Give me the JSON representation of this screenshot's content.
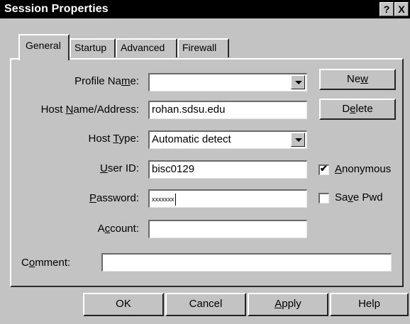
{
  "window": {
    "title": "Session Properties",
    "help_glyph": "?",
    "close_glyph": "X"
  },
  "tabs": [
    {
      "label": "General",
      "active": true
    },
    {
      "label": "Startup",
      "active": false
    },
    {
      "label": "Advanced",
      "active": false
    },
    {
      "label": "Firewall",
      "active": false
    }
  ],
  "form": {
    "profile_name": {
      "label_pre": "Profile Na",
      "label_key": "m",
      "label_post": "e:",
      "value": ""
    },
    "host_name": {
      "label_pre": "Host ",
      "label_key": "N",
      "label_post": "ame/Address:",
      "value": "rohan.sdsu.edu"
    },
    "host_type": {
      "label_pre": "Host ",
      "label_key": "T",
      "label_post": "ype:",
      "value": "Automatic detect"
    },
    "user_id": {
      "label_pre": "",
      "label_key": "U",
      "label_post": "ser ID:",
      "value": "bisc0129"
    },
    "password": {
      "label_pre": "",
      "label_key": "P",
      "label_post": "assword:",
      "value": "xxxxxxx"
    },
    "account": {
      "label_pre": "A",
      "label_key": "c",
      "label_post": "count:",
      "value": ""
    },
    "comment": {
      "label_pre": "C",
      "label_key": "o",
      "label_post": "mment:",
      "value": ""
    }
  },
  "side_buttons": {
    "new": {
      "pre": "Ne",
      "key": "w",
      "post": ""
    },
    "delete": {
      "pre": "D",
      "key": "e",
      "post": "lete"
    }
  },
  "checkboxes": {
    "anonymous": {
      "pre": "",
      "key": "A",
      "post": "nonymous",
      "checked": true,
      "mark": "✔"
    },
    "save_pwd": {
      "pre": "Sa",
      "key": "v",
      "post": "e Pwd",
      "checked": false,
      "mark": ""
    }
  },
  "footer_buttons": {
    "ok": "OK",
    "cancel": "Cancel",
    "apply": {
      "pre": "",
      "key": "A",
      "post": "pply"
    },
    "help": "Help"
  },
  "colors": {
    "dialog_face": "#c3c3c3",
    "title_bar": "#000000",
    "field_bg": "#ffffff"
  }
}
